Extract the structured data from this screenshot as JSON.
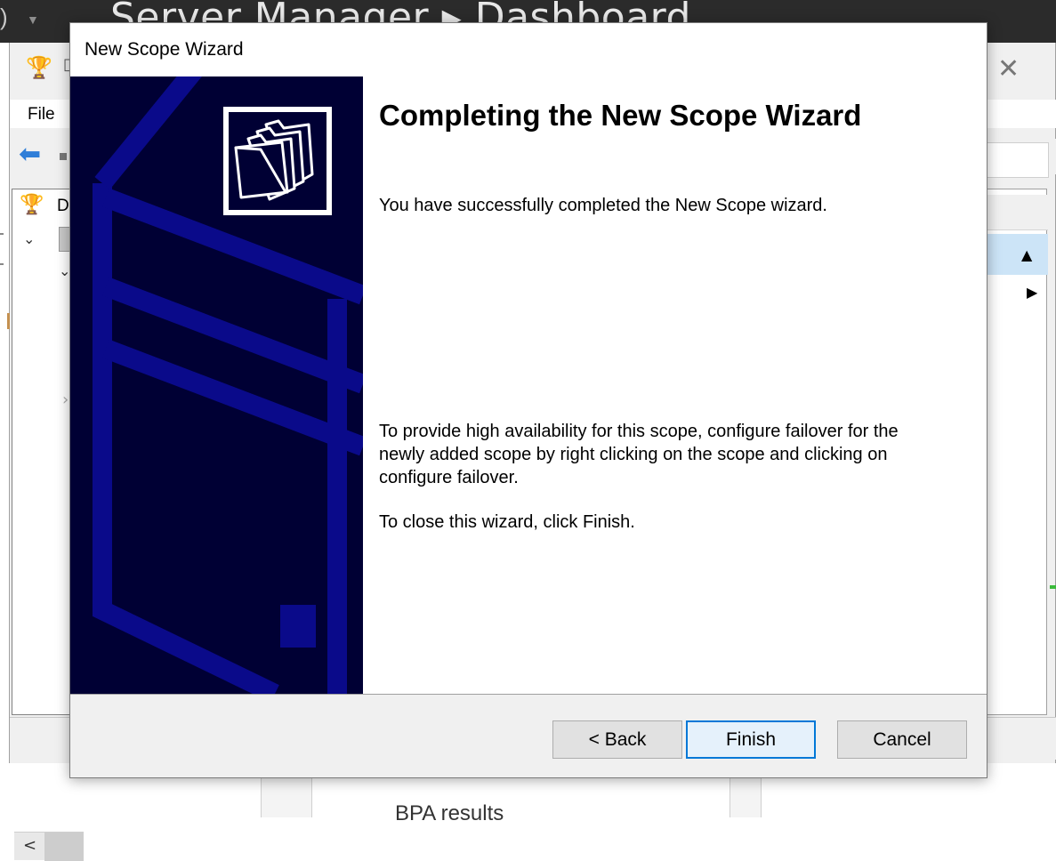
{
  "background_window": {
    "title": "Server Manager ▸ Dashboard",
    "dhcp_window": {
      "menu_file": "File",
      "tree_item_label": "D",
      "icons": {
        "app": "dhcp-app-icon",
        "close": "close-icon",
        "back": "back-arrow-icon",
        "scroll_left": "scroll-left-icon",
        "scroll_up": "scroll-up-icon",
        "expand_right": "expand-right-icon"
      }
    },
    "dashboard_tile": "BPA results"
  },
  "wizard": {
    "title": "New Scope Wizard",
    "heading": "Completing the New Scope Wizard",
    "paragraph1": "You have successfully completed the New Scope wizard.",
    "paragraph2": "To provide high availability for this scope, configure failover for the newly added scope by right clicking on the scope and clicking on configure failover.",
    "paragraph3": "To close this wizard, click Finish.",
    "banner_icon": "folder-stack-icon",
    "buttons": {
      "back": "< Back",
      "finish": "Finish",
      "cancel": "Cancel"
    }
  },
  "colors": {
    "banner_bg": "#000034",
    "banner_lines": "#0a0a8a",
    "focus_accent": "#0078d7",
    "dialog_footer": "#f0f0f0"
  }
}
